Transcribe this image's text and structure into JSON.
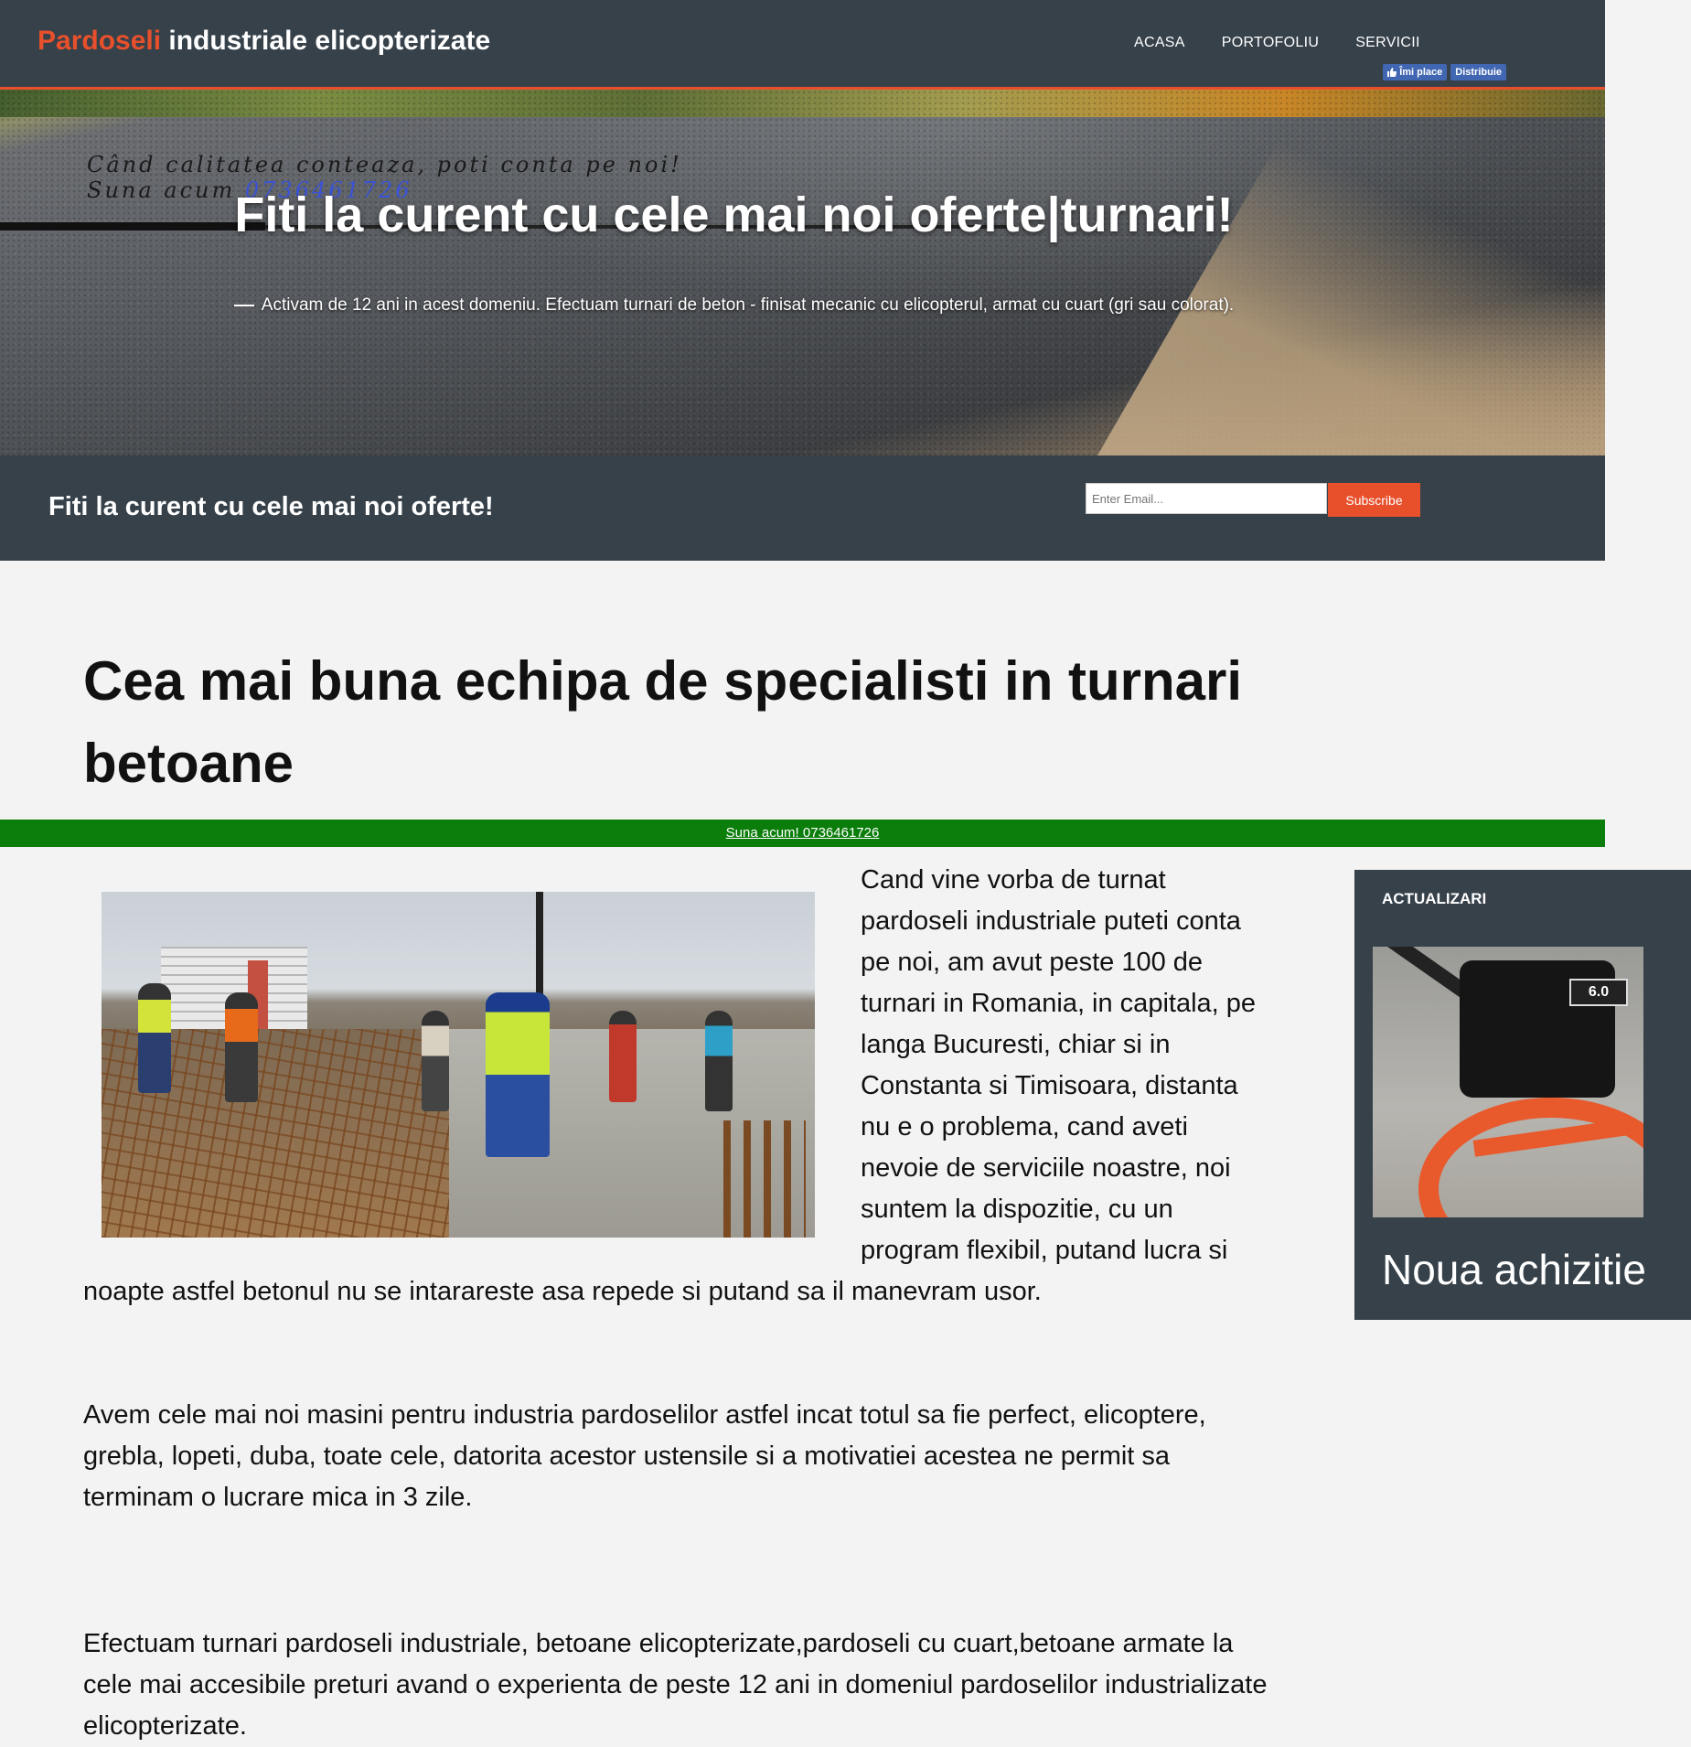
{
  "header": {
    "brand_accent": "Pardoseli",
    "brand_rest": " industriale elicopterizate",
    "nav": [
      "ACASA",
      "PORTOFOLIU",
      "SERVICII"
    ],
    "fb_like": "Îmi place",
    "fb_share": "Distribuie"
  },
  "hero": {
    "slogan_line1": "Când calitatea conteaza, poti conta pe noi!",
    "slogan_line2_prefix": "Suna acum ",
    "slogan_phone": "0736461726",
    "title": "Fiti la curent cu cele mai noi oferte|turnari!",
    "subtitle": "Activam de 12 ani in acest domeniu. Efectuam turnari de beton - finisat mecanic cu elicopterul, armat cu cuart (gri sau colorat)."
  },
  "subscribe": {
    "heading": "Fiti la curent cu cele mai noi oferte!",
    "email_placeholder": "Enter Email...",
    "button": "Subscribe"
  },
  "main": {
    "title": "Cea mai buna echipa de specialisti in turnari betoane",
    "call_link": "Suna acum! 0736461726",
    "para1": "Cand vine vorba de turnat pardoseli industriale puteti conta pe noi, am avut peste 100 de turnari in Romania, in capitala, pe langa Bucuresti, chiar si in Constanta si Timisoara, distanta nu e o problema, cand aveti nevoie de serviciile noastre, noi suntem la dispozitie, cu un program flexibil, putand lucra si noapte astfel betonul nu se intarareste asa repede si putand sa il manevram usor.",
    "para2": "Avem cele mai noi masini pentru industria pardoselilor astfel incat totul sa fie perfect, elicoptere, grebla, lopeti, duba, toate cele, datorita acestor ustensile si a motivatiei acestea ne permit sa terminam o lucrare mica in 3 zile.",
    "para3": "Efectuam turnari pardoseli industriale, betoane elicopterizate,pardoseli cu cuart,betoane armate la cele mai accesibile preturi avand o experienta de peste 12 ani in domeniul pardoselilor industrializate elicopterizate."
  },
  "sidebar": {
    "heading": "ACTUALIZARI",
    "engine_label": "6.0",
    "caption": "Noua achizitie"
  },
  "colors": {
    "accent": "#e8502c",
    "dark": "#36414a",
    "callbar": "#0a7d0a",
    "phone_blue": "#3a53d6"
  }
}
